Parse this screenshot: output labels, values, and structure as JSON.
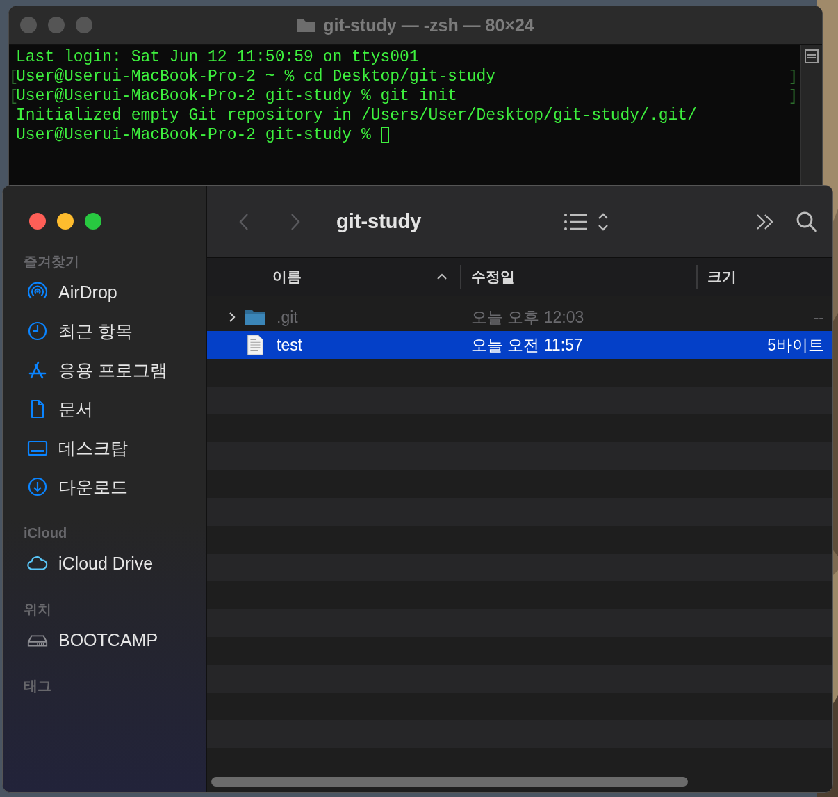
{
  "terminal": {
    "title": "git-study — -zsh — 80×24",
    "lines": [
      {
        "text": "Last login: Sat Jun 12 11:50:59 on ttys001",
        "cursor": false
      },
      {
        "text": "User@Userui-MacBook-Pro-2 ~ % cd Desktop/git-study",
        "open_mark": "[",
        "close_mark": "]",
        "cursor": false
      },
      {
        "text": "User@Userui-MacBook-Pro-2 git-study % git init",
        "open_mark": "[",
        "close_mark": "]",
        "cursor": false
      },
      {
        "text": "Initialized empty Git repository in /Users/User/Desktop/git-study/.git/",
        "cursor": false
      },
      {
        "text": "User@Userui-MacBook-Pro-2 git-study % ",
        "cursor": true
      }
    ]
  },
  "finder": {
    "title": "git-study",
    "sidebar": [
      {
        "heading": "즐겨찾기",
        "items": [
          {
            "label": "AirDrop",
            "kind": "airdrop"
          },
          {
            "label": "최근 항목",
            "kind": "clock"
          },
          {
            "label": "응용 프로그램",
            "kind": "apps"
          },
          {
            "label": "문서",
            "kind": "doc"
          },
          {
            "label": "데스크탑",
            "kind": "desktop"
          },
          {
            "label": "다운로드",
            "kind": "download"
          }
        ]
      },
      {
        "heading": "iCloud",
        "items": [
          {
            "label": "iCloud Drive",
            "kind": "cloud"
          }
        ]
      },
      {
        "heading": "위치",
        "items": [
          {
            "label": "BOOTCAMP",
            "kind": "disk"
          }
        ]
      },
      {
        "heading": "태그"
      }
    ],
    "columns": [
      {
        "label": "이름",
        "sorted": true
      },
      {
        "label": "수정일",
        "sorted": false
      },
      {
        "label": "크기",
        "sorted": false
      }
    ],
    "rows": [
      {
        "name": ".git",
        "kind": "folder",
        "hidden": true,
        "date": "오늘 오후 12:03",
        "size": "--",
        "selected": false
      },
      {
        "name": "test",
        "kind": "file",
        "hidden": false,
        "date": "오늘 오전 11:57",
        "size": "5바이트",
        "selected": true
      }
    ]
  }
}
